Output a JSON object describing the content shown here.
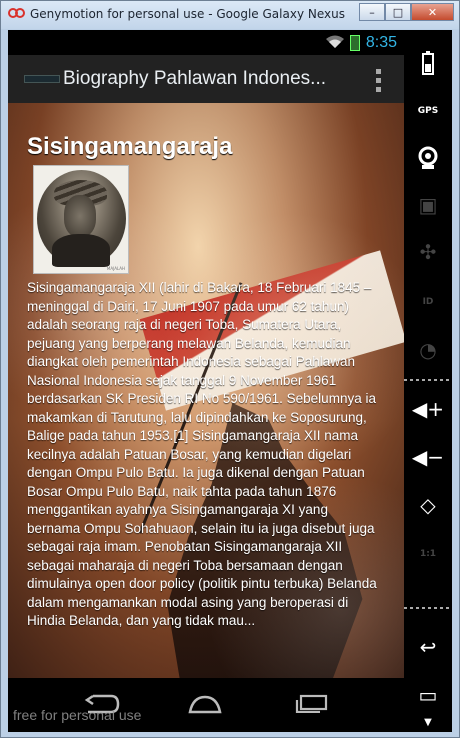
{
  "window": {
    "title": "Genymotion for personal use - Google Galaxy Nexus - 4.1....",
    "buttons": {
      "minimize": "–",
      "maximize": "□",
      "close": "✕"
    }
  },
  "statusbar": {
    "time": "8:35",
    "icons": [
      "wifi-icon",
      "battery-charging-icon"
    ]
  },
  "actionbar": {
    "title": "Biography Pahlawan Indones...",
    "menu_icon": "overflow-menu-icon"
  },
  "article": {
    "title": "Sisingamangaraja",
    "portrait_caption": "MAJALAH",
    "body": "Sisingamangaraja XII (lahir di Bakara, 18 Februari 1845 – meninggal di Dairi, 17 Juni 1907 pada umur 62 tahun) adalah seorang raja di negeri Toba, Sumatera Utara, pejuang yang berperang melawan Belanda, kemudian diangkat oleh pemerintah Indonesia sebagai Pahlawan Nasional Indonesia sejak tanggal 9 November 1961 berdasarkan SK Presiden RI No 590/1961. Sebelumnya ia makamkan di Tarutung, lalu dipindahkan ke Soposurung, Balige pada tahun 1953.[1] Sisingamangaraja XII nama kecilnya adalah Patuan Bosar, yang kemudian digelari dengan Ompu Pulo Batu. Ia juga dikenal dengan Patuan Bosar Ompu Pulo Batu, naik tahta pada tahun 1876 menggantikan ayahnya Sisingamangaraja XI yang bernama Ompu Sohahuaon, selain itu ia juga disebut juga sebagai raja imam. Penobatan Sisingamangaraja XII sebagai maharaja di negeri Toba bersamaan dengan dimulainya open door policy (politik pintu terbuka) Belanda dalam mengamankan modal asing yang beroperasi di Hindia Belanda, dan yang tidak mau..."
  },
  "navbar": {
    "icons": [
      "back-nav-icon",
      "home-nav-icon",
      "recent-apps-icon"
    ]
  },
  "watermark": "free for personal use",
  "sidebar": {
    "icons": [
      "battery-icon",
      "gps-icon",
      "camera-icon",
      "clapper-icon",
      "dpad-icon",
      "id-icon",
      "cast-icon",
      "volume-up-icon",
      "volume-down-icon",
      "rotate-icon",
      "scale-icon",
      "back-icon",
      "recent-icon",
      "menu-arrow-icon"
    ],
    "gps_label": "GPS",
    "id_label": "ID",
    "scale_label": "1:1"
  }
}
